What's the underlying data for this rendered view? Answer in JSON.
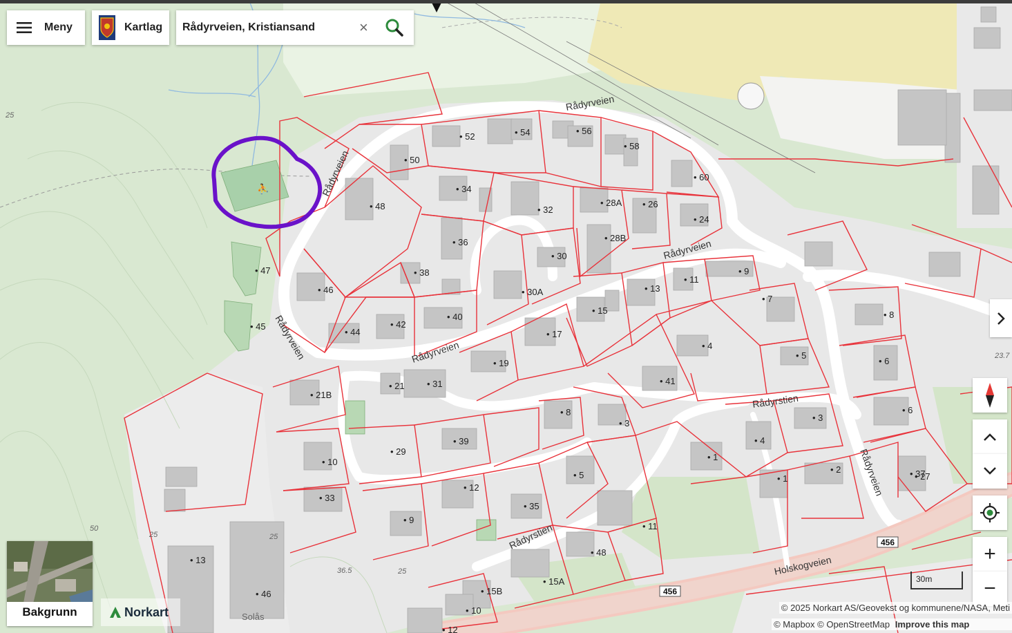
{
  "toolbar": {
    "menu_label": "Meny",
    "layers_label": "Kartlag",
    "search_value": "Rådyrveien, Kristiansand",
    "clear_symbol": "×"
  },
  "map": {
    "street_labels": [
      "Rådyrveien",
      "Rådyrveien",
      "Rådyrveien",
      "Rådyrveien",
      "Rådyrveien",
      "Rådyrveien",
      "Rådyrstien",
      "Rådyrstien",
      "Holskogveien"
    ],
    "road_shields": [
      "456",
      "456"
    ],
    "house_numbers": [
      "52",
      "54",
      "56",
      "58",
      "50",
      "60",
      "34",
      "32",
      "48",
      "28A",
      "26",
      "24",
      "36",
      "28B",
      "30",
      "47",
      "38",
      "46",
      "30A",
      "13",
      "15",
      "11",
      "9",
      "7",
      "45",
      "44",
      "42",
      "40",
      "17",
      "4",
      "8",
      "5",
      "19",
      "6",
      "41",
      "21B",
      "21",
      "31",
      "8",
      "3",
      "3",
      "4",
      "6",
      "27",
      "29",
      "39",
      "10",
      "5",
      "1",
      "1",
      "2",
      "37",
      "33",
      "12",
      "35",
      "9",
      "11",
      "48",
      "13",
      "15A",
      "46",
      "15B",
      "10",
      "12"
    ],
    "place_labels": [
      "Solås"
    ],
    "elevation_labels": [
      "25",
      "25",
      "50",
      "25",
      "25",
      "36.5",
      "25",
      "23.7"
    ]
  },
  "controls": {
    "compass": "compass-icon",
    "pan_up": "chevron-up-icon",
    "pan_down": "chevron-down-icon",
    "locate": "locate-icon",
    "zoom_in": "+",
    "zoom_out": "−",
    "expand": "chevron-right-icon"
  },
  "basemap": {
    "label": "Bakgrunn"
  },
  "branding": {
    "logo_text": "Norkart"
  },
  "attribution": {
    "line1": "© 2025 Norkart AS/Geovekst og kommunene/NASA, Meti",
    "line2_mapbox": "© Mapbox",
    "line2_osm": "© OpenStreetMap",
    "line2_improve": "Improve this map"
  },
  "scale": {
    "label": "30m"
  },
  "colors": {
    "forest": "#d7e6cf",
    "residential": "#e7e7e7",
    "road": "#ffffff",
    "parcel": "#e8323a",
    "building": "#c4c4c4",
    "farmland": "#f0eab8",
    "highlight_circle": "#6a12c9",
    "search_icon": "#2d8b3c",
    "compass_red": "#e53935"
  }
}
